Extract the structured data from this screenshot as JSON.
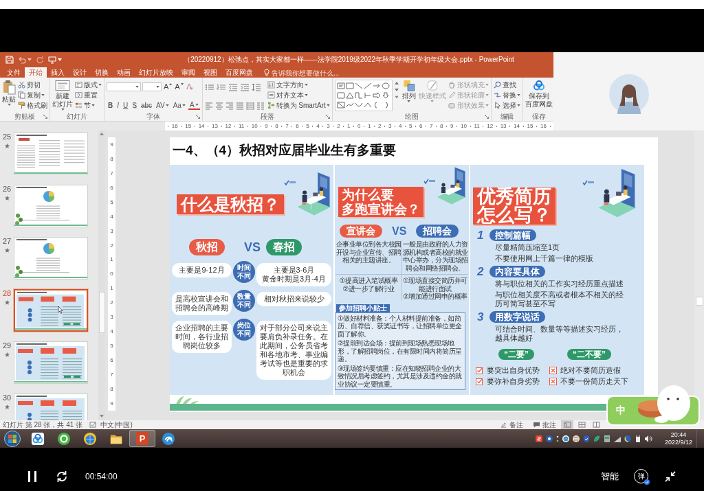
{
  "powerpoint": {
    "title": "（20220912）松弛点，其实大家都一样——法学院2019级2022年秋季学期开学初年级大会.pptx - PowerPoint",
    "tabs": [
      {
        "label": "文件",
        "selected": false
      },
      {
        "label": "开始",
        "selected": true
      },
      {
        "label": "插入",
        "selected": false
      },
      {
        "label": "设计",
        "selected": false
      },
      {
        "label": "切换",
        "selected": false
      },
      {
        "label": "动画",
        "selected": false
      },
      {
        "label": "幻灯片放映",
        "selected": false
      },
      {
        "label": "审阅",
        "selected": false
      },
      {
        "label": "视图",
        "selected": false
      },
      {
        "label": "百度网盘",
        "selected": false
      }
    ],
    "tell_me": {
      "placeholder": "告诉我你想要做什么..."
    },
    "ribbon": {
      "clipboard": {
        "paste": "粘贴",
        "cut": "剪切",
        "copy": "复制",
        "painter": "格式刷",
        "label": "剪贴板"
      },
      "slides": {
        "new_slide": [
          "新建",
          "幻灯片"
        ],
        "layout": "版式",
        "reset": "重置",
        "section": "节",
        "label": "幻灯片"
      },
      "font": {
        "size_buttons": [
          "A",
          "A"
        ],
        "format_buttons": [
          "B",
          "I",
          "U",
          "S",
          "abc",
          "AV",
          "Aa",
          "A"
        ],
        "label": "字体"
      },
      "paragraph": {
        "text_direction": "文字方向",
        "align_text": "对齐文本",
        "smartart": "转换为 SmartArt",
        "label": "段落"
      },
      "drawing": {
        "arrange": "排列",
        "quick_styles": "快速样式",
        "fill": "形状填充",
        "outline": "形状轮廓",
        "effects": "形状效果",
        "label": "绘图"
      },
      "editing": {
        "find": "查找",
        "replace": "替换",
        "select": "选择",
        "label": "编辑"
      },
      "save": {
        "button": [
          "保存到",
          "百度网盘"
        ],
        "label": "保存"
      }
    },
    "ruler": {
      "horizontal": [
        "16",
        "15",
        "14",
        "13",
        "12",
        "11",
        "10",
        "9",
        "8",
        "7",
        "6",
        "5",
        "4",
        "3",
        "2",
        "1",
        "0",
        "1",
        "2",
        "3",
        "4",
        "5",
        "6",
        "7",
        "8",
        "9",
        "10",
        "11",
        "12",
        "13",
        "14",
        "15",
        "16"
      ],
      "vertical": [
        "9",
        "8",
        "7",
        "6",
        "5",
        "4",
        "3",
        "2",
        "1",
        "0",
        "1",
        "2",
        "3",
        "4",
        "5",
        "6",
        "7",
        "8",
        "9"
      ]
    },
    "thumbnails": [
      {
        "number": "25",
        "kind": "text",
        "selected": false
      },
      {
        "number": "26",
        "kind": "chart",
        "selected": false
      },
      {
        "number": "27",
        "kind": "chart",
        "selected": false
      },
      {
        "number": "28",
        "kind": "infographic",
        "selected": true
      },
      {
        "number": "29",
        "kind": "infographic",
        "selected": false
      },
      {
        "number": "30",
        "kind": "infographic",
        "selected": false
      }
    ],
    "slide": {
      "title": "一4、（4）秋招对应届毕业生有多重要",
      "panels": [
        {
          "kind": "compare",
          "banner": [
            "什么是秋招？"
          ],
          "tags": [
            {
              "label": "秋招",
              "color": "#e85c46"
            },
            {
              "label": "春招",
              "color": "#2e9868"
            }
          ],
          "vs": "VS",
          "rows": [
            {
              "left": [
                "主要是9-12月"
              ],
              "middle": "时间不同",
              "right": [
                "主要是3-6月",
                "黄金时期是3月-4月"
              ]
            },
            {
              "left": [
                "是高校宣讲会和招聘会的高峰期"
              ],
              "middle": "数量不同",
              "right": [
                "相对秋招来说较少"
              ]
            },
            {
              "left": [
                "企业招聘的主要时间，各行业招聘岗位较多"
              ],
              "middle": "岗位不同",
              "right": [
                "对于部分公司来说主要肩负补录任务。在此期间，公务员省考和各地市考、事业编考试等也是重要的求职机会"
              ]
            }
          ]
        },
        {
          "kind": "events",
          "banner": [
            "为什么要",
            "多跑宣讲会？"
          ],
          "tags": [
            {
              "label": "宣讲会",
              "color": "#e85c46"
            },
            {
              "label": "招聘会",
              "color": "#3d6db4"
            }
          ],
          "vs": "VS",
          "descriptions": [
            "企事业单位到各大校园开设与企业宣传、招聘相关的主题讲座。",
            "一般是由政府的人力资源机构或者高校的就业中心举办，分为现场招聘会和网络招聘会。"
          ],
          "benefits": [
            [
              "①提高进入笔试概率",
              "②进一步了解行业"
            ],
            [
              "①现场直接交简历并可能进行面试",
              "②增加通过网申的概率"
            ]
          ],
          "tips_title": "参加招聘小贴士",
          "tips": [
            "①做好材料准备：个人材料提前准备，如简历、自荐信、获奖证书等，让招聘单位更全面了解你。",
            "②提前到达会场：提前到现场熟悉现场地形，了解招聘岗位，在有限时间内将简历呈递。",
            "③现场签约要慎重：应在知晓招聘企业的大致情况后考虑签约，尤其是涉及违约金的就业协议一定要慎重。"
          ]
        },
        {
          "kind": "resume",
          "banner": [
            "优秀简历",
            "怎么写？"
          ],
          "steps": [
            {
              "number": "1",
              "title": "控制篇幅",
              "lines": [
                "尽量精简压缩至1页",
                "不要使用网上千篇一律的模版"
              ]
            },
            {
              "number": "2",
              "title": "内容要具体",
              "lines": [
                "将与职位相关的工作实习经历重点描述",
                "与职位相关度不高或者根本不相关的经历可简写甚至不写"
              ]
            },
            {
              "number": "3",
              "title": "用数字说话",
              "lines": [
                "可结合时间、数量等等描述实习经历，越具体越好"
              ]
            }
          ],
          "dos": {
            "title": "“二要”",
            "items": [
              "要突出自身优势",
              "要弥补自身劣势"
            ]
          },
          "donts": {
            "title": "“二不要”",
            "items": [
              "绝对不要简历造假",
              "不要一份简历走天下"
            ]
          }
        }
      ]
    },
    "status_bar": {
      "position": "幻灯片 第 28 张，共 41 张",
      "language": "中文(中国)",
      "notes": "备注",
      "comments": "批注",
      "views": [
        {
          "selected": true
        },
        {
          "selected": false
        },
        {
          "selected": false
        }
      ]
    }
  },
  "taskbar": {
    "apps": [
      {
        "kind": "cloud",
        "selected": false
      },
      {
        "kind": "ring",
        "selected": false
      },
      {
        "kind": "globe",
        "selected": false
      },
      {
        "kind": "folder",
        "selected": false
      },
      {
        "kind": "slides",
        "label": "P",
        "selected": true
      },
      {
        "kind": "swirl",
        "selected": false
      }
    ],
    "time": "20:44",
    "date": "2022/9/12"
  },
  "input_method": {
    "mode": "中"
  },
  "player": {
    "playing": true,
    "time": "00:54:00",
    "quality": "智能",
    "danmaku": "弹"
  }
}
